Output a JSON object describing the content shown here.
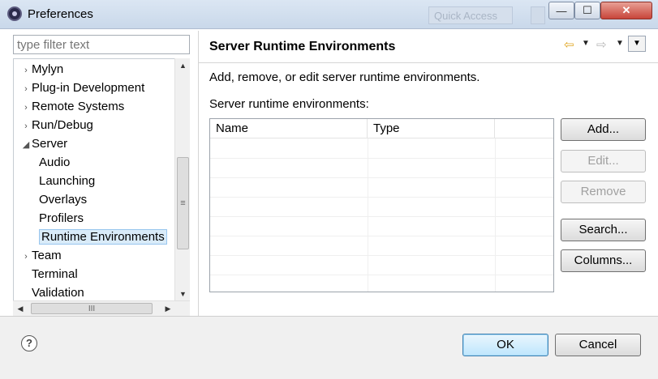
{
  "window": {
    "title": "Preferences",
    "quick_access_placeholder": "Quick Access",
    "min_glyph": "—",
    "max_glyph": "☐",
    "close_glyph": "✕"
  },
  "filter": {
    "placeholder": "type filter text",
    "value": ""
  },
  "tree": {
    "items": [
      {
        "label": "Mylyn",
        "arrow": "›",
        "level": 0
      },
      {
        "label": "Plug-in Development",
        "arrow": "›",
        "level": 0
      },
      {
        "label": "Remote Systems",
        "arrow": "›",
        "level": 0
      },
      {
        "label": "Run/Debug",
        "arrow": "›",
        "level": 0
      },
      {
        "label": "Server",
        "arrow": "◢",
        "level": 0
      },
      {
        "label": "Audio",
        "arrow": "",
        "level": 1
      },
      {
        "label": "Launching",
        "arrow": "",
        "level": 1
      },
      {
        "label": "Overlays",
        "arrow": "",
        "level": 1
      },
      {
        "label": "Profilers",
        "arrow": "",
        "level": 1
      },
      {
        "label": "Runtime Environments",
        "arrow": "",
        "level": 1,
        "selected": true
      },
      {
        "label": "Team",
        "arrow": "›",
        "level": 0
      },
      {
        "label": "Terminal",
        "arrow": "",
        "level": 0
      },
      {
        "label": "Validation",
        "arrow": "",
        "level": 0
      }
    ],
    "scroll_up": "▲",
    "scroll_down": "▼",
    "scroll_left": "◀",
    "scroll_right": "▶",
    "vthumb_grip": "≡",
    "hthumb_grip": "III"
  },
  "page": {
    "title": "Server Runtime Environments",
    "description": "Add, remove, or edit server runtime environments.",
    "list_label": "Server runtime environments:",
    "nav_back": "⇦",
    "nav_fwd": "⇨",
    "nav_dropdown": "▼",
    "view_menu": "▼"
  },
  "table": {
    "columns": [
      "Name",
      "Type",
      ""
    ],
    "rows": []
  },
  "buttons": {
    "add": "Add...",
    "edit": "Edit...",
    "remove": "Remove",
    "search": "Search...",
    "columns": "Columns..."
  },
  "footer": {
    "help": "?",
    "ok": "OK",
    "cancel": "Cancel"
  }
}
